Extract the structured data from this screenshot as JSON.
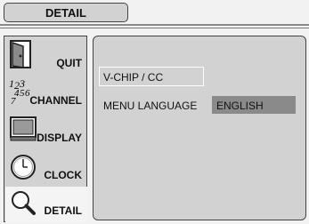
{
  "header": {
    "title": "DETAIL"
  },
  "sidebar": {
    "items": [
      {
        "label": "QUIT",
        "icon": "door-icon"
      },
      {
        "label": "CHANNEL",
        "icon": "channel-numbers-icon"
      },
      {
        "label": "DISPLAY",
        "icon": "monitor-icon"
      },
      {
        "label": "CLOCK",
        "icon": "clock-icon"
      },
      {
        "label": "DETAIL",
        "icon": "magnifier-icon",
        "active": true
      }
    ]
  },
  "panel": {
    "vchip_label": "V-CHIP / CC",
    "menu_language_label": "MENU LANGUAGE",
    "menu_language_value": "ENGLISH"
  }
}
